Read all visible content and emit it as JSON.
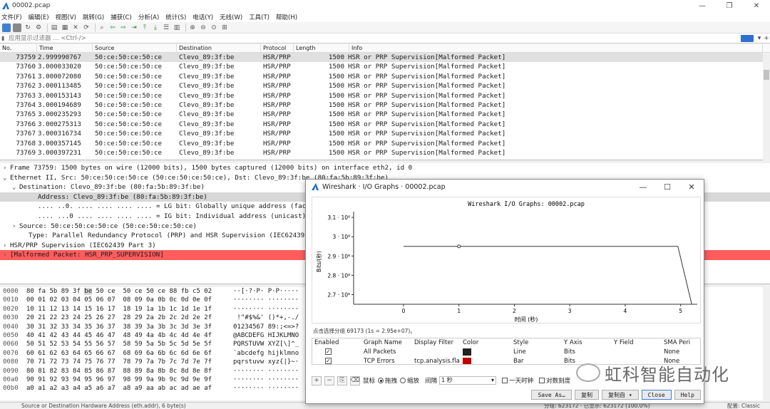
{
  "window": {
    "title": "00002.pcap",
    "controls": [
      "—",
      "❐",
      "✕"
    ]
  },
  "menu": [
    "文件(F)",
    "编辑(E)",
    "视图(V)",
    "跳转(G)",
    "捕获(C)",
    "分析(A)",
    "统计(S)",
    "电话(Y)",
    "无线(W)",
    "工具(T)",
    "帮助(H)"
  ],
  "filter": {
    "placeholder": "应用显示过滤器 … <Ctrl-/>"
  },
  "packet_list": {
    "headers": [
      "No.",
      "Time",
      "Source",
      "Destination",
      "Protocol",
      "Length",
      "Info"
    ],
    "rows": [
      [
        "73759",
        "2.999990767",
        "50:ce:50:ce:50:ce",
        "Clevo_89:3f:be",
        "HSR/PRP",
        "1500",
        "HSR or PRP Supervision[Malformed Packet]"
      ],
      [
        "73760",
        "3.000033020",
        "50:ce:50:ce:50:ce",
        "Clevo_89:3f:be",
        "HSR/PRP",
        "1500",
        "HSR or PRP Supervision[Malformed Packet]"
      ],
      [
        "73761",
        "3.000072080",
        "50:ce:50:ce:50:ce",
        "Clevo_89:3f:be",
        "HSR/PRP",
        "1500",
        "HSR or PRP Supervision[Malformed Packet]"
      ],
      [
        "73762",
        "3.000113485",
        "50:ce:50:ce:50:ce",
        "Clevo_89:3f:be",
        "HSR/PRP",
        "1500",
        "HSR or PRP Supervision[Malformed Packet]"
      ],
      [
        "73763",
        "3.000153143",
        "50:ce:50:ce:50:ce",
        "Clevo_89:3f:be",
        "HSR/PRP",
        "1500",
        "HSR or PRP Supervision[Malformed Packet]"
      ],
      [
        "73764",
        "3.000194689",
        "50:ce:50:ce:50:ce",
        "Clevo_89:3f:be",
        "HSR/PRP",
        "1500",
        "HSR or PRP Supervision[Malformed Packet]"
      ],
      [
        "73765",
        "3.000235293",
        "50:ce:50:ce:50:ce",
        "Clevo_89:3f:be",
        "HSR/PRP",
        "1500",
        "HSR or PRP Supervision[Malformed Packet]"
      ],
      [
        "73766",
        "3.000275313",
        "50:ce:50:ce:50:ce",
        "Clevo_89:3f:be",
        "HSR/PRP",
        "1500",
        "HSR or PRP Supervision[Malformed Packet]"
      ],
      [
        "73767",
        "3.000316734",
        "50:ce:50:ce:50:ce",
        "Clevo_89:3f:be",
        "HSR/PRP",
        "1500",
        "HSR or PRP Supervision[Malformed Packet]"
      ],
      [
        "73768",
        "3.000357145",
        "50:ce:50:ce:50:ce",
        "Clevo_89:3f:be",
        "HSR/PRP",
        "1500",
        "HSR or PRP Supervision[Malformed Packet]"
      ],
      [
        "73769",
        "3.000397231",
        "50:ce:50:ce:50:ce",
        "Clevo_89:3f:be",
        "HSR/PRP",
        "1500",
        "HSR or PRP Supervision[Malformed Packet]"
      ]
    ]
  },
  "details": [
    {
      "arrow": "›",
      "indent": 0,
      "text": "Frame 73759: 1500 bytes on wire (12000 bits), 1500 bytes captured (12000 bits) on interface eth2, id 0",
      "style": ""
    },
    {
      "arrow": "⌄",
      "indent": 0,
      "text": "Ethernet II, Src: 50:ce:50:ce:50:ce (50:ce:50:ce:50:ce), Dst: Clevo_89:3f:be (80:fa:5b:89:3f:be)",
      "style": ""
    },
    {
      "arrow": "⌄",
      "indent": 1,
      "text": "Destination: Clevo_89:3f:be (80:fa:5b:89:3f:be)",
      "style": ""
    },
    {
      "arrow": "",
      "indent": 3,
      "text": "Address: Clevo_89:3f:be (80:fa:5b:89:3f:be)",
      "style": "hl"
    },
    {
      "arrow": "",
      "indent": 3,
      "text": ".... ..0. .... .... .... .... = LG bit: Globally unique address (factory default)",
      "style": ""
    },
    {
      "arrow": "",
      "indent": 3,
      "text": ".... ...0 .... .... .... .... = IG bit: Individual address (unicast)",
      "style": ""
    },
    {
      "arrow": "›",
      "indent": 1,
      "text": "Source: 50:ce:50:ce:50:ce (50:ce:50:ce:50:ce)",
      "style": ""
    },
    {
      "arrow": "",
      "indent": 2,
      "text": "Type: Parallel Redundancy Protocol (PRP) and HSR Supervision (IEC62439 Part 3) (0x88fb)",
      "style": ""
    },
    {
      "arrow": "›",
      "indent": 0,
      "text": "HSR/PRP Supervision (IEC62439 Part 3)",
      "style": ""
    },
    {
      "arrow": "›",
      "indent": 0,
      "text": "[Malformed Packet: HSR_PRP_SUPERVISION]",
      "style": "mal"
    }
  ],
  "bytes": [
    {
      "off": "0000",
      "hex_a": "80 fa 5b 89 3f ",
      "hex_sel": "be",
      "hex_b": " 50 ce  50 ce 50 ce 88 fb c5 02",
      "ascii": "··[·?·P· P·P·····"
    },
    {
      "off": "0010",
      "hex_a": "00 01 02 03 04 05 06 07  08 09 0a 0b 0c 0d 0e 0f",
      "hex_sel": "",
      "hex_b": "",
      "ascii": "········ ········"
    },
    {
      "off": "0020",
      "hex_a": "10 11 12 13 14 15 16 17  18 19 1a 1b 1c 1d 1e 1f",
      "hex_sel": "",
      "hex_b": "",
      "ascii": "········ ········"
    },
    {
      "off": "0030",
      "hex_a": "20 21 22 23 24 25 26 27  28 29 2a 2b 2c 2d 2e 2f",
      "hex_sel": "",
      "hex_b": "",
      "ascii": " !\"#$%&' ()*+,-./"
    },
    {
      "off": "0040",
      "hex_a": "30 31 32 33 34 35 36 37  38 39 3a 3b 3c 3d 3e 3f",
      "hex_sel": "",
      "hex_b": "",
      "ascii": "01234567 89:;<=>?"
    },
    {
      "off": "0050",
      "hex_a": "40 41 42 43 44 45 46 47  48 49 4a 4b 4c 4d 4e 4f",
      "hex_sel": "",
      "hex_b": "",
      "ascii": "@ABCDEFG HIJKLMNO"
    },
    {
      "off": "0060",
      "hex_a": "50 51 52 53 54 55 56 57  58 59 5a 5b 5c 5d 5e 5f",
      "hex_sel": "",
      "hex_b": "",
      "ascii": "PQRSTUVW XYZ[\\]^_"
    },
    {
      "off": "0070",
      "hex_a": "60 61 62 63 64 65 66 67  68 69 6a 6b 6c 6d 6e 6f",
      "hex_sel": "",
      "hex_b": "",
      "ascii": "`abcdefg hijklmno"
    },
    {
      "off": "0080",
      "hex_a": "70 71 72 73 74 75 76 77  78 79 7a 7b 7c 7d 7e 7f",
      "hex_sel": "",
      "hex_b": "",
      "ascii": "pqrstuvw xyz{|}~·"
    },
    {
      "off": "0090",
      "hex_a": "80 81 82 83 84 85 86 87  88 89 8a 8b 8c 8d 8e 8f",
      "hex_sel": "",
      "hex_b": "",
      "ascii": "········ ········"
    },
    {
      "off": "00a0",
      "hex_a": "90 91 92 93 94 95 96 97  98 99 9a 9b 9c 9d 9e 9f",
      "hex_sel": "",
      "hex_b": "",
      "ascii": "········ ········"
    },
    {
      "off": "00b0",
      "hex_a": "a0 a1 a2 a3 a4 a5 a6 a7  a8 a9 aa ab ac ad ae af",
      "hex_sel": "",
      "hex_b": "",
      "ascii": "········ ········"
    }
  ],
  "status": {
    "left": "Source or Destination Hardware Address (eth.addr), 6 byte(s)",
    "right": "分组: 623172 · 已显示: 623172 (100.0%)",
    "profile": "配置: Classic"
  },
  "io_dialog": {
    "title": "Wireshark · I/O Graphs · 00002.pcap",
    "hint": "点击选择分组 69173 (1s = 2.95e+07)。",
    "table_headers": [
      "Enabled",
      "Graph Name",
      "Display Filter",
      "Color",
      "Style",
      "Y Axis",
      "Y Field",
      "SMA Peri"
    ],
    "rows": [
      {
        "name": "All Packets",
        "filter": "",
        "color": "#222222",
        "style": "Line",
        "yaxis": "Bits",
        "yfield": "",
        "sma": "None"
      },
      {
        "name": "TCP Errors",
        "filter": "tcp.analysis.fla",
        "color": "#c00000",
        "style": "Bar",
        "yaxis": "Bits",
        "yfield": "",
        "sma": "None"
      }
    ],
    "mouse_label": "鼠标",
    "drag_label": "拖拽",
    "zoom_label": "缩放",
    "interval_label": "间隔",
    "interval_value": "1 秒",
    "time_of_day_label": "一天时钟",
    "log_scale_label": "对数刻度",
    "buttons": {
      "save": "Save As…",
      "copy": "复制",
      "copy_from": "复制自",
      "close": "Close",
      "help": "Help"
    }
  },
  "chart_data": {
    "type": "line",
    "title": "Wireshark I/O Graphs: 00002.pcap",
    "xlabel": "时间 (秒)",
    "ylabel": "Bits/(秒)",
    "xlim": [
      -0.9,
      5.3
    ],
    "ylim": [
      26500000,
      31300000
    ],
    "xticks": [
      0,
      1,
      2,
      3,
      4,
      5
    ],
    "yticks": [
      27000000,
      28000000,
      29000000,
      30000000,
      31000000
    ],
    "ytick_labels": [
      "2.7 · 10⁸",
      "2.8 · 10⁸",
      "2.9 · 10⁸",
      "3 · 10⁸",
      "3.1 · 10⁸"
    ],
    "series": [
      {
        "name": "All Packets",
        "x": [
          0,
          1,
          2,
          3,
          4,
          4.95,
          5.2
        ],
        "y": [
          29500000,
          29500000,
          29500000,
          29500000,
          29500000,
          29500000,
          26500000
        ]
      }
    ],
    "marker": {
      "x": 1,
      "y": 29500000
    }
  },
  "watermark": {
    "text": "虹科智能自动化"
  }
}
